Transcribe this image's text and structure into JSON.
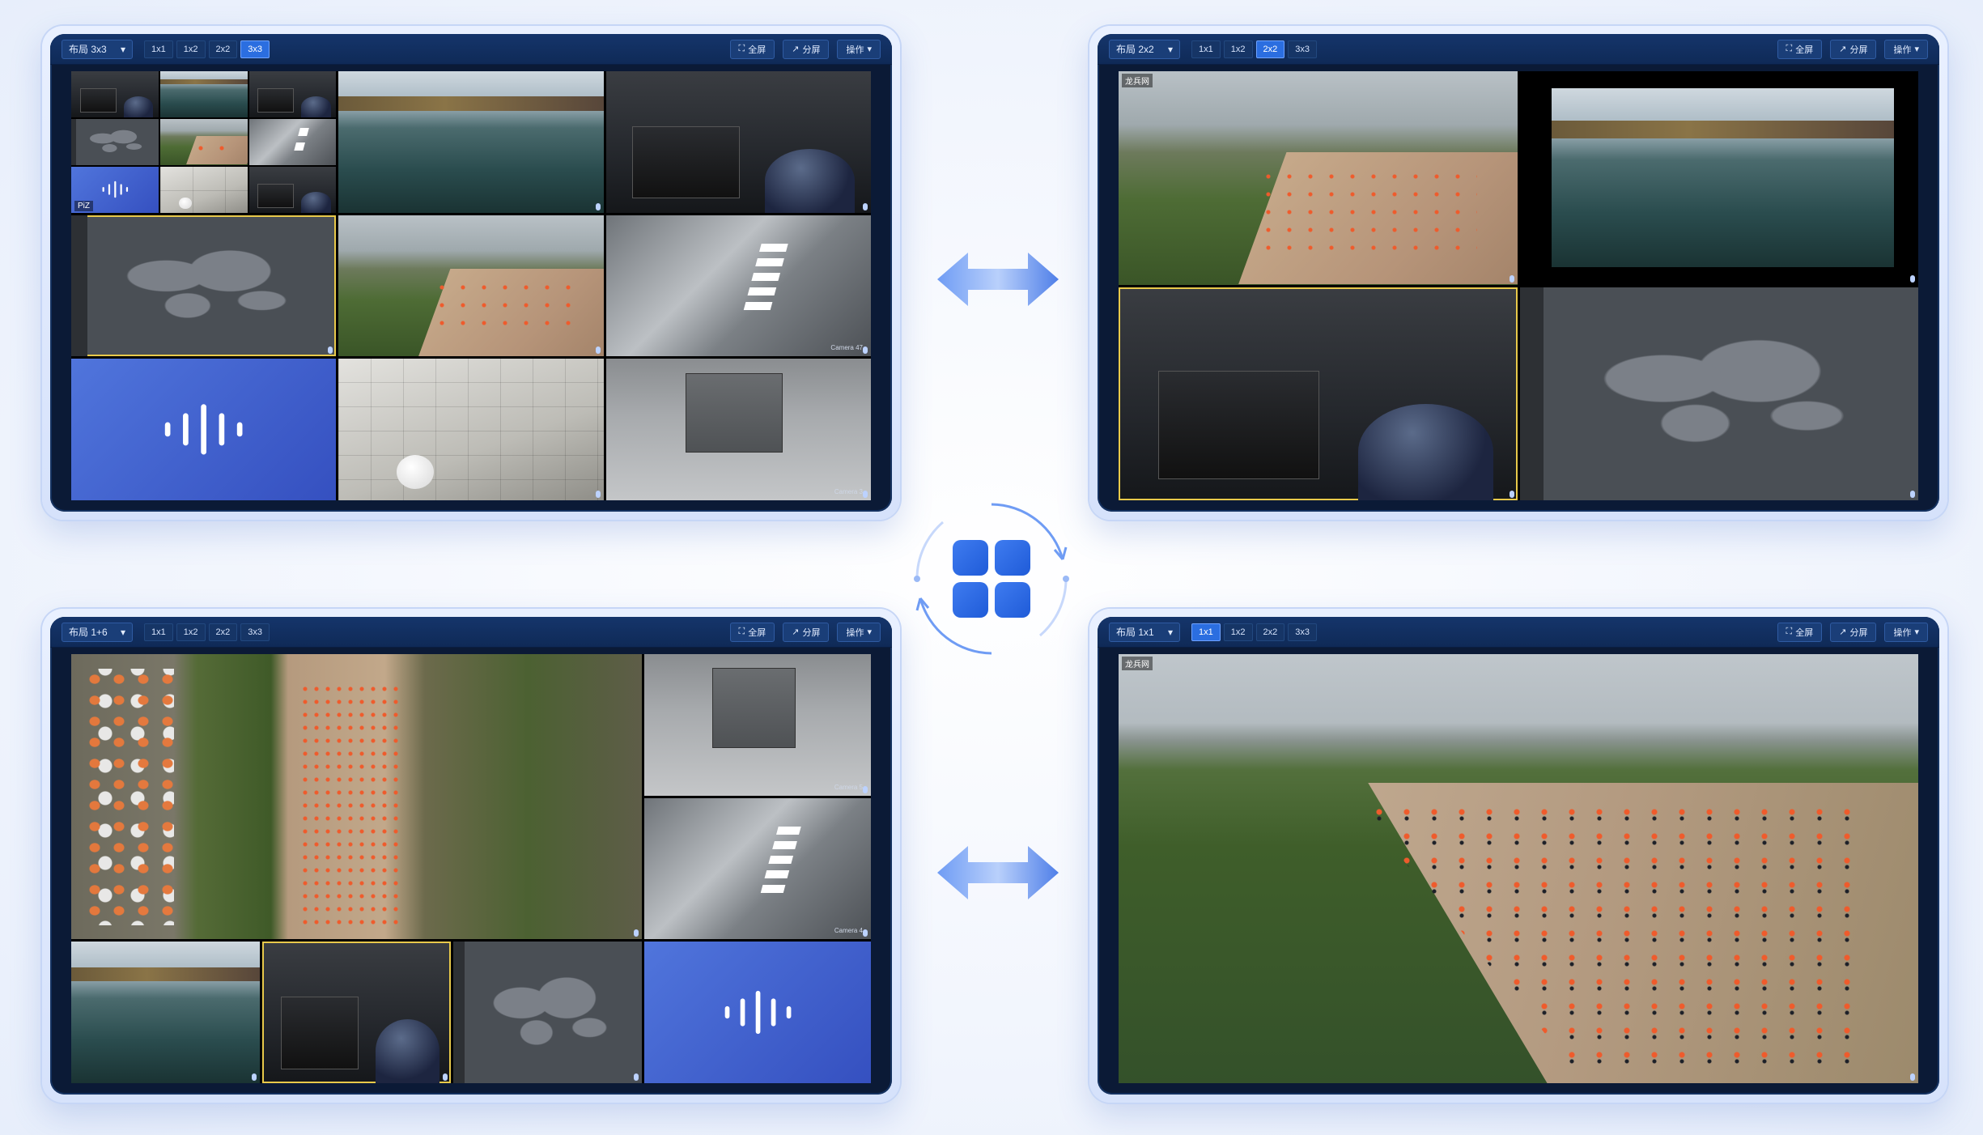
{
  "colors": {
    "accent": "#2b6ee0",
    "toolbar": "#15356b",
    "audio": "#4a6fd8",
    "selected": "#e8c94a"
  },
  "grid_options": [
    "1x1",
    "1x2",
    "2x2",
    "3x3"
  ],
  "actions": {
    "fullscreen": "全屏",
    "split": "分屏",
    "operate": "操作"
  },
  "icons": {
    "center": "layout-grid-icon",
    "arrows": "bidirectional-arrow-icon"
  },
  "panels": {
    "top_left": {
      "layout_label": "布局 3x3",
      "active_grid": "3x3",
      "cells": {
        "mini_label": "PiZ",
        "cam1": "Camera 47",
        "cam2": "Camera 3"
      }
    },
    "top_right": {
      "layout_label": "布局 2x2",
      "active_grid": "2x2",
      "cells": {
        "label1": "龙兵网"
      }
    },
    "bottom_left": {
      "layout_label": "布局 1+6",
      "active_grid": "",
      "cells": {
        "cam1": "Camera 5",
        "cam2": "Camera 4"
      }
    },
    "bottom_right": {
      "layout_label": "布局 1x1",
      "active_grid": "1x1",
      "cells": {
        "label1": "龙兵网"
      }
    }
  }
}
